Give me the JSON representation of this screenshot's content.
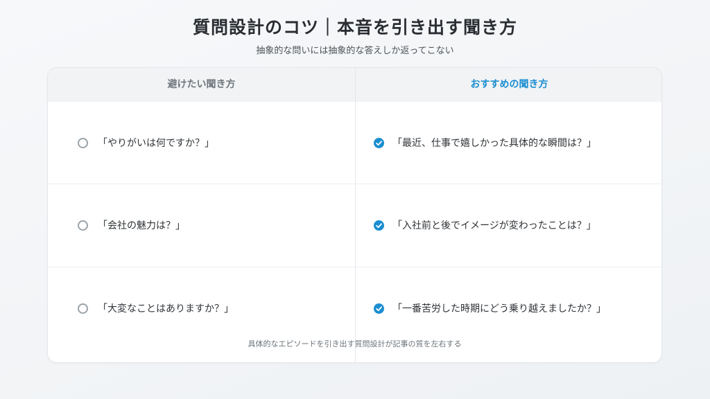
{
  "title": "質問設計のコツ｜本音を引き出す聞き方",
  "subtitle": "抽象的な問いには抽象的な答えしか返ってこない",
  "columns": {
    "avoid_label": "避けたい聞き方",
    "recommend_label": "おすすめの聞き方"
  },
  "rows": [
    {
      "avoid": "「やりがいは何ですか？」",
      "recommend": "「最近、仕事で嬉しかった具体的な瞬間は？」"
    },
    {
      "avoid": "「会社の魅力は？」",
      "recommend": "「入社前と後でイメージが変わったことは？」"
    },
    {
      "avoid": "「大変なことはありますか？」",
      "recommend": "「一番苦労した時期にどう乗り越えましたか？」"
    }
  ],
  "footer": "具体的なエピソードを引き出す質問設計が記事の質を左右する",
  "colors": {
    "accent": "#1a8ed0",
    "muted_icon": "#9aa2a9"
  },
  "icons": {
    "avoid": "circle-outline-icon",
    "recommend": "check-circle-icon"
  }
}
